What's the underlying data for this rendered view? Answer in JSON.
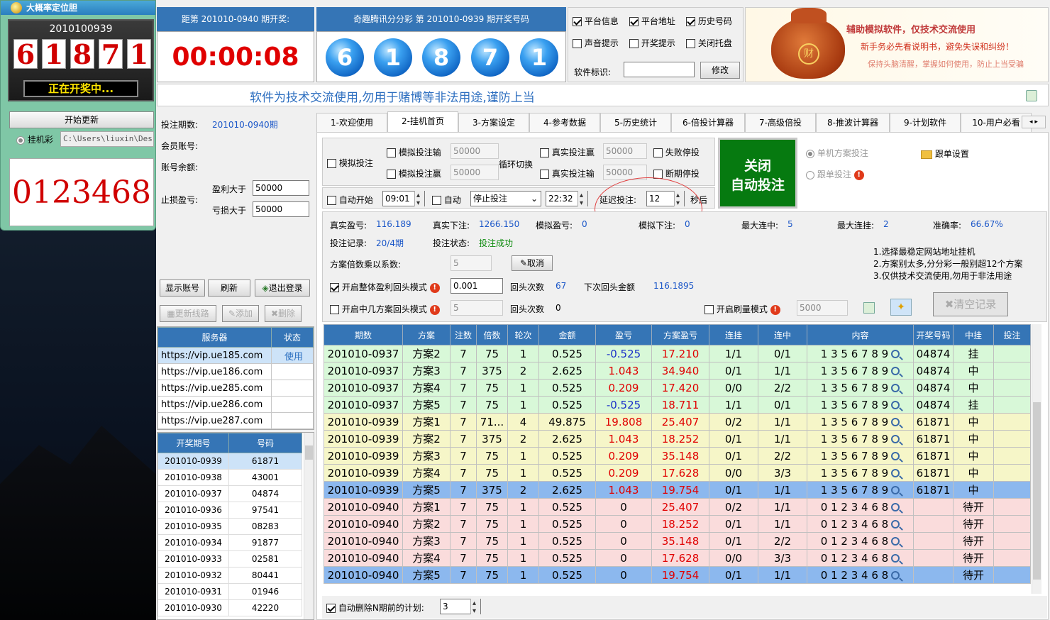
{
  "widget": {
    "title": "大概率定位胆",
    "period": "2010100939",
    "digits": [
      "6",
      "1",
      "8",
      "7",
      "1"
    ],
    "status": "正在开奖中...",
    "update_btn": "开始更新",
    "radio_label": "挂机彩",
    "path": "C:\\Users\\liuxin\\Deskto",
    "big_number": "0123468"
  },
  "header": {
    "countdown_title": "距第 201010-0940 期开奖:",
    "countdown": "00:00:08",
    "draw_title": "奇趣腾讯分分彩 第 201010-0939 期开奖号码",
    "balls": [
      "6",
      "1",
      "8",
      "7",
      "1"
    ],
    "options": [
      {
        "label": "平台信息",
        "checked": true
      },
      {
        "label": "平台地址",
        "checked": true
      },
      {
        "label": "历史号码",
        "checked": true
      },
      {
        "label": "声音提示",
        "checked": false
      },
      {
        "label": "开奖提示",
        "checked": false
      },
      {
        "label": "关闭托盘",
        "checked": false
      }
    ],
    "soft_id_label": "软件标识:",
    "modify_btn": "修改",
    "ad_lines": [
      "辅助模拟软件，仅技术交流使用",
      "新手务必先看说明书，避免失误和纠纷！",
      "保持头脑清醒，掌握如何使用，防止上当受骗"
    ],
    "ad_coin": "财",
    "marquee": "软件为技术交流使用,勿用于赌博等非法用途,谨防上当"
  },
  "account": {
    "period_label": "投注期数:",
    "period_value": "201010-0940期",
    "member_label": "会员账号:",
    "balance_label": "账号余额:",
    "stop_label": "止损盈亏:",
    "profit_label": "盈利大于",
    "profit_value": "50000",
    "loss_label": "亏损大于",
    "loss_value": "50000",
    "btn_show": "显示账号",
    "btn_refresh": "刷新",
    "btn_logout": "退出登录",
    "btn_update": "更新线路",
    "btn_add": "添加",
    "btn_delete": "删除"
  },
  "servers": {
    "col_server": "服务器",
    "col_status": "状态",
    "rows": [
      {
        "url": "https://vip.ue185.com",
        "status": "使用"
      },
      {
        "url": "https://vip.ue186.com",
        "status": ""
      },
      {
        "url": "https://vip.ue285.com",
        "status": ""
      },
      {
        "url": "https://vip.ue286.com",
        "status": ""
      },
      {
        "url": "https://vip.ue287.com",
        "status": ""
      }
    ]
  },
  "history": {
    "col_period": "开奖期号",
    "col_number": "号码",
    "rows": [
      [
        "201010-0939",
        "61871"
      ],
      [
        "201010-0938",
        "43001"
      ],
      [
        "201010-0937",
        "04874"
      ],
      [
        "201010-0936",
        "97541"
      ],
      [
        "201010-0935",
        "08283"
      ],
      [
        "201010-0934",
        "91877"
      ],
      [
        "201010-0933",
        "02581"
      ],
      [
        "201010-0932",
        "80441"
      ],
      [
        "201010-0931",
        "01946"
      ],
      [
        "201010-0930",
        "42220"
      ]
    ]
  },
  "tabs": [
    "1-欢迎使用",
    "2-挂机首页",
    "3-方案设定",
    "4-参考数据",
    "5-历史统计",
    "6-倍投计算器",
    "7-高级倍投",
    "8-推波计算器",
    "9-计划软件",
    "10-用户必看"
  ],
  "controls": {
    "sim_bet": "模拟投注",
    "sim_loss": "模拟投注输",
    "sim_win": "模拟投注赢",
    "sim_loss_val": "50000",
    "sim_win_val": "50000",
    "loop_switch": "循环切换",
    "real_win": "真实投注赢",
    "real_loss": "真实投注输",
    "real_win_val": "50000",
    "real_loss_val": "50000",
    "fail_stop": "失败停投",
    "break_stop": "断期停投",
    "auto_start": "自动开始",
    "start_time": "09:01",
    "auto": "自动",
    "stop_select": "停止投注",
    "stop_time": "22:32",
    "delay_label": "延迟投注:",
    "delay_value": "12",
    "seconds": "秒后",
    "close_auto_1": "关闭",
    "close_auto_2": "自动投注",
    "single_bet": "单机方案投注",
    "follow_settings": "跟单设置",
    "follow_bet": "跟单投注"
  },
  "stats": {
    "real_profit_label": "真实盈亏:",
    "real_profit": "116.189",
    "real_bet_label": "真实下注:",
    "real_bet": "1266.150",
    "sim_profit_label": "模拟盈亏:",
    "sim_profit": "0",
    "sim_bet_label": "模拟下注:",
    "sim_bet": "0",
    "max_lose_label": "最大连中:",
    "max_lose": "5",
    "max_win_label": "最大连挂:",
    "max_win": "2",
    "accuracy_label": "准确率:",
    "accuracy": "66.67%",
    "record_label": "投注记录:",
    "record": "20/4期",
    "state_label": "投注状态:",
    "state": "投注成功",
    "multiplier_label": "方案倍数乘以系数:",
    "multiplier": "5",
    "cancel_btn": "取消",
    "notes": [
      "1.选择最稳定网站地址挂机",
      "2.方案别太多,分分彩一般别超12个方案",
      "3.仅供技术交流使用,勿用于非法用途"
    ],
    "mode1_label": "开启整体盈利回头模式",
    "mode1_value": "0.001",
    "back_count_label": "回头次数",
    "back_count": "67",
    "next_amount_label": "下次回头金额",
    "next_amount": "116.1895",
    "mode2_label": "开启中几方案回头模式",
    "mode2_value": "5",
    "back_count2_label": "回头次数",
    "back_count2": "0",
    "brush_label": "开启刷量模式",
    "brush_value": "5000",
    "clear_btn": "清空记录"
  },
  "table": {
    "headers": [
      "期数",
      "方案",
      "注数",
      "倍数",
      "轮次",
      "金额",
      "盈亏",
      "方案盈亏",
      "连挂",
      "连中",
      "内容",
      "开奖号码",
      "中挂",
      "投注"
    ],
    "rows": [
      {
        "t": "g",
        "c": [
          "201010-0937",
          "方案2",
          "7",
          "75",
          "1",
          "0.525",
          "-0.525",
          "17.210",
          "1/1",
          "0/1",
          "1 3 5 6 7 8 9",
          "04874",
          "挂",
          ""
        ],
        "n": true
      },
      {
        "t": "g",
        "c": [
          "201010-0937",
          "方案3",
          "7",
          "375",
          "2",
          "2.625",
          "1.043",
          "34.940",
          "0/1",
          "1/1",
          "1 3 5 6 7 8 9",
          "04874",
          "中",
          ""
        ]
      },
      {
        "t": "g",
        "c": [
          "201010-0937",
          "方案4",
          "7",
          "75",
          "1",
          "0.525",
          "0.209",
          "17.420",
          "0/0",
          "2/2",
          "1 3 5 6 7 8 9",
          "04874",
          "中",
          ""
        ]
      },
      {
        "t": "g",
        "c": [
          "201010-0937",
          "方案5",
          "7",
          "75",
          "1",
          "0.525",
          "-0.525",
          "18.711",
          "1/1",
          "0/1",
          "1 3 5 6 7 8 9",
          "04874",
          "挂",
          ""
        ],
        "n": true
      },
      {
        "t": "y",
        "c": [
          "201010-0939",
          "方案1",
          "7",
          "71...",
          "4",
          "49.875",
          "19.808",
          "25.407",
          "0/2",
          "1/1",
          "1 3 5 6 7 8 9",
          "61871",
          "中",
          ""
        ]
      },
      {
        "t": "y",
        "c": [
          "201010-0939",
          "方案2",
          "7",
          "375",
          "2",
          "2.625",
          "1.043",
          "18.252",
          "0/1",
          "1/1",
          "1 3 5 6 7 8 9",
          "61871",
          "中",
          ""
        ]
      },
      {
        "t": "y",
        "c": [
          "201010-0939",
          "方案3",
          "7",
          "75",
          "1",
          "0.525",
          "0.209",
          "35.148",
          "0/1",
          "2/2",
          "1 3 5 6 7 8 9",
          "61871",
          "中",
          ""
        ]
      },
      {
        "t": "y",
        "c": [
          "201010-0939",
          "方案4",
          "7",
          "75",
          "1",
          "0.525",
          "0.209",
          "17.628",
          "0/0",
          "3/3",
          "1 3 5 6 7 8 9",
          "61871",
          "中",
          ""
        ]
      },
      {
        "t": "s",
        "c": [
          "201010-0939",
          "方案5",
          "7",
          "375",
          "2",
          "2.625",
          "1.043",
          "19.754",
          "0/1",
          "1/1",
          "1 3 5 6 7 8 9",
          "61871",
          "中",
          ""
        ]
      },
      {
        "t": "p",
        "c": [
          "201010-0940",
          "方案1",
          "7",
          "75",
          "1",
          "0.525",
          "0",
          "25.407",
          "0/2",
          "1/1",
          "0 1 2 3 4 6 8",
          "",
          "待开",
          ""
        ],
        "z": true
      },
      {
        "t": "p",
        "c": [
          "201010-0940",
          "方案2",
          "7",
          "75",
          "1",
          "0.525",
          "0",
          "18.252",
          "0/1",
          "1/1",
          "0 1 2 3 4 6 8",
          "",
          "待开",
          ""
        ],
        "z": true
      },
      {
        "t": "p",
        "c": [
          "201010-0940",
          "方案3",
          "7",
          "75",
          "1",
          "0.525",
          "0",
          "35.148",
          "0/1",
          "2/2",
          "0 1 2 3 4 6 8",
          "",
          "待开",
          ""
        ],
        "z": true
      },
      {
        "t": "p",
        "c": [
          "201010-0940",
          "方案4",
          "7",
          "75",
          "1",
          "0.525",
          "0",
          "17.628",
          "0/0",
          "3/3",
          "0 1 2 3 4 6 8",
          "",
          "待开",
          ""
        ],
        "z": true
      },
      {
        "t": "s",
        "c": [
          "201010-0940",
          "方案5",
          "7",
          "75",
          "1",
          "0.525",
          "0",
          "19.754",
          "0/1",
          "1/1",
          "0 1 2 3 4 6 8",
          "",
          "待开",
          ""
        ],
        "z": true
      }
    ]
  },
  "footer": {
    "auto_delete": "自动删除N期前的计划:",
    "auto_delete_val": "3"
  }
}
